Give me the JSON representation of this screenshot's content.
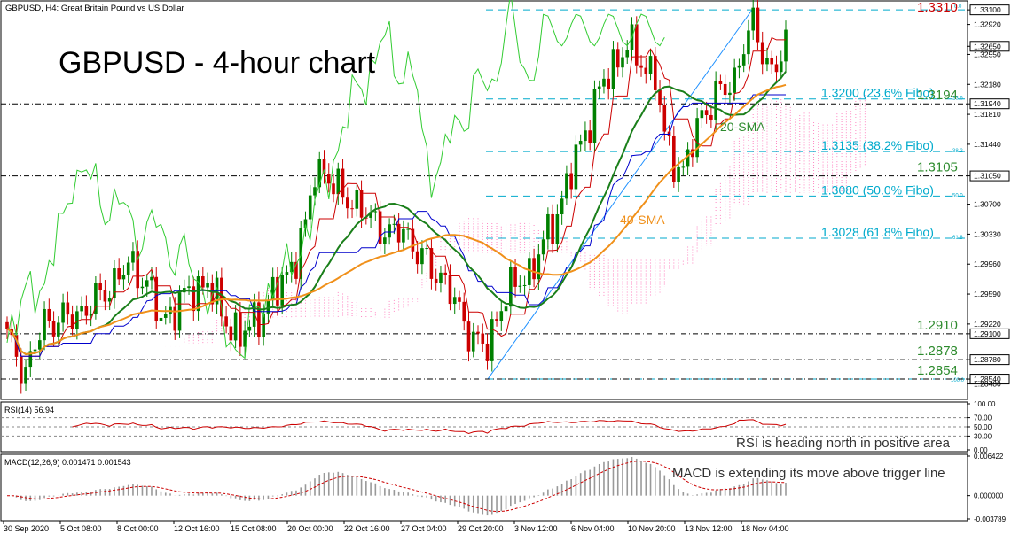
{
  "header": {
    "symbol_info": "GBPUSD, H4:  Great Britain Pound vs US Dollar",
    "title": "GBPUSD - 4-hour chart"
  },
  "colors": {
    "bull": "#008000",
    "bear": "#cc0000",
    "sma20": "#1a7f1a",
    "sma40": "#f0901a",
    "tenkan": "#cc0000",
    "kijun": "#0000cc",
    "chikou": "#33cc33",
    "cloud": "#ff69b4",
    "fibo": "#00aacc",
    "level_text": "#2e8b2e",
    "highlight": "#cc0000"
  },
  "chart_data": [
    {
      "type": "candlestick",
      "title": "GBPUSD - 4-hour chart",
      "timeframe": "H4",
      "ylim": [
        1.283,
        1.332
      ],
      "y_ticks": [
        "1.33100",
        "1.32920",
        "1.32650",
        "1.32550",
        "1.32180",
        "1.31940",
        "1.31810",
        "1.31440",
        "1.31050",
        "1.30700",
        "1.30330",
        "1.29960",
        "1.29590",
        "1.29220",
        "1.29100",
        "1.28780",
        "1.28540",
        "1.28480"
      ],
      "x_tick_labels": [
        "30 Sep 2020",
        "5 Oct 08:00",
        "8 Oct 00:00",
        "12 Oct 16:00",
        "15 Oct 08:00",
        "20 Oct 00:00",
        "22 Oct 16:00",
        "27 Oct 04:00",
        "29 Oct 20:00",
        "3 Nov 12:00",
        "6 Nov 04:00",
        "10 Nov 20:00",
        "13 Nov 12:00",
        "18 Nov 04:00"
      ],
      "last_price": "1.32650",
      "horizontal_levels": [
        {
          "label": "1.3310",
          "value": 1.331,
          "boxed": true
        },
        {
          "label": "1.3194",
          "value": 1.3194,
          "boxed": true
        },
        {
          "label": "1.3105",
          "value": 1.3105,
          "boxed": true
        },
        {
          "label": "1.2910",
          "value": 1.291,
          "boxed": true
        },
        {
          "label": "1.2878",
          "value": 1.2878,
          "boxed": true
        },
        {
          "label": "1.2854",
          "value": 1.2854,
          "boxed": true
        }
      ],
      "fibonacci_retracement": {
        "low": 1.2854,
        "high": 1.331,
        "levels": [
          {
            "label": "1.3200 (23.6% Fibo)",
            "small": "23.6",
            "value": 1.32
          },
          {
            "label": "1.3135 (38.2% Fibo)",
            "small": "38.2",
            "value": 1.3135
          },
          {
            "label": "1.3080 (50.0% Fibo)",
            "small": "50.0",
            "value": 1.308
          },
          {
            "label": "1.3028 (61.8% Fibo)",
            "small": "61.8",
            "value": 1.3028
          }
        ],
        "end_labels": {
          "top": "0.0",
          "bottom": "100.0"
        }
      },
      "annotations": [
        {
          "text": "20-SMA"
        },
        {
          "text": "40-SMA"
        }
      ]
    },
    {
      "type": "line",
      "title": "RSI(14) 56.94",
      "ylim": [
        0,
        100
      ],
      "y_ticks": [
        "100.00",
        "70.00",
        "50.00",
        "30.00",
        "0.00"
      ],
      "current": 56.94,
      "annotation": "RSI is heading north in positive area"
    },
    {
      "type": "bar",
      "title": "MACD(12,26,9) 0.001471 0.001543",
      "ylim": [
        -0.003789,
        0.006422
      ],
      "y_ticks": [
        "0.006422",
        "0.000000",
        "-0.003789"
      ],
      "macd": 0.001471,
      "signal": 0.001543,
      "annotation": "MACD is extending its move above trigger line"
    }
  ]
}
